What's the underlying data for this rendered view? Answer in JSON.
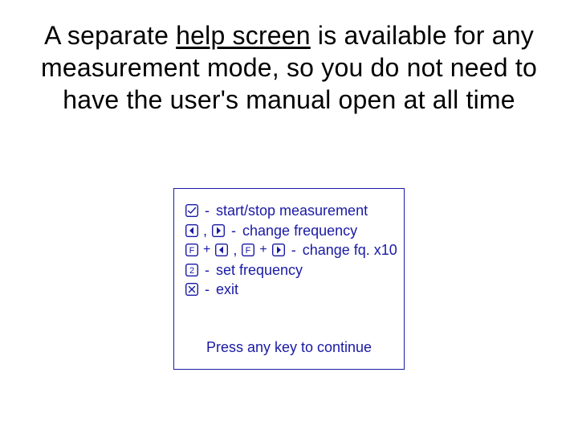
{
  "title": {
    "pre": "A separate ",
    "underlined": "help screen",
    "post": " is available for any measurement mode, so you do not need to have the user's manual open at all time"
  },
  "help": {
    "rows": {
      "r1": {
        "desc": "start/stop measurement"
      },
      "r2": {
        "desc": "change frequency"
      },
      "r3": {
        "key_letter": "F",
        "desc": "change fq. x10"
      },
      "r4": {
        "key_digit": "2",
        "desc": "set frequency"
      },
      "r5": {
        "desc": "exit"
      }
    },
    "sep_comma": ",",
    "sep_plus": "+",
    "sep_dash": "-",
    "footer": "Press any key to continue"
  }
}
